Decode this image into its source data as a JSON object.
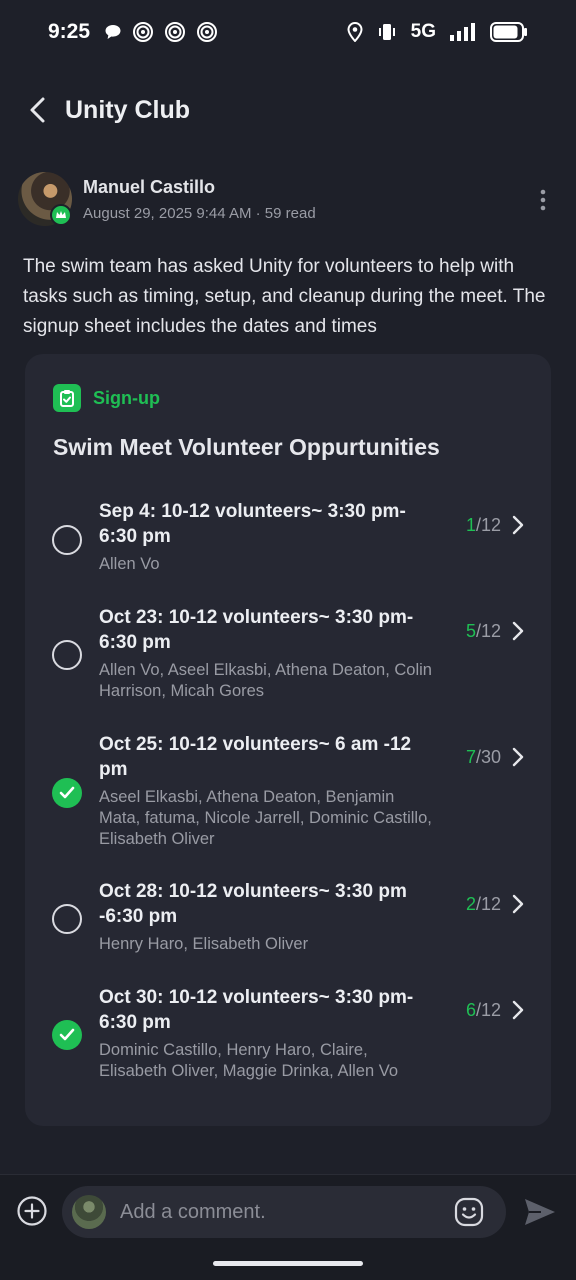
{
  "status_bar": {
    "time": "9:25",
    "network": "5G",
    "left_icons": [
      "chat-bubble-icon",
      "threads-icon",
      "threads-icon",
      "threads-icon"
    ],
    "right_icons": [
      "location-icon",
      "vibrate-icon",
      "signal-icon",
      "battery-icon"
    ]
  },
  "header": {
    "title": "Unity Club"
  },
  "post": {
    "author": "Manuel Castillo",
    "meta": "August 29, 2025 9:44 AM · 59 read",
    "body": "The swim team has asked Unity for volunteers to help with tasks such as timing, setup, and cleanup during the meet. The signup sheet includes the dates and times"
  },
  "signup": {
    "tag": "Sign-up",
    "title": "Swim Meet Volunteer Oppurtunities",
    "slots": [
      {
        "title": "Sep 4: 10-12 volunteers~ 3:30 pm-6:30 pm",
        "names": "Allen Vo",
        "current": "1",
        "total": "/12",
        "checked": false
      },
      {
        "title": "Oct 23: 10-12 volunteers~ 3:30 pm-6:30 pm",
        "names": "Allen Vo, Aseel Elkasbi, Athena Deaton, Colin Harrison, Micah Gores",
        "current": "5",
        "total": "/12",
        "checked": false
      },
      {
        "title": "Oct 25: 10-12 volunteers~ 6 am -12 pm",
        "names": "Aseel Elkasbi, Athena Deaton, Benjamin Mata, fatuma, Nicole Jarrell, Dominic Castillo, Elisabeth Oliver",
        "current": "7",
        "total": "/30",
        "checked": true
      },
      {
        "title": "Oct 28: 10-12 volunteers~ 3:30 pm -6:30 pm",
        "names": "Henry Haro, Elisabeth Oliver",
        "current": "2",
        "total": "/12",
        "checked": false
      },
      {
        "title": "Oct 30: 10-12 volunteers~ 3:30 pm-6:30 pm",
        "names": "Dominic Castillo, Henry Haro, Claire, Elisabeth Oliver, Maggie Drinka, Allen Vo",
        "current": "6",
        "total": "/12",
        "checked": true
      }
    ]
  },
  "comment_bar": {
    "placeholder": "Add a comment."
  },
  "colors": {
    "accent": "#1fbf54",
    "background": "#1e2029",
    "card": "#262833"
  }
}
